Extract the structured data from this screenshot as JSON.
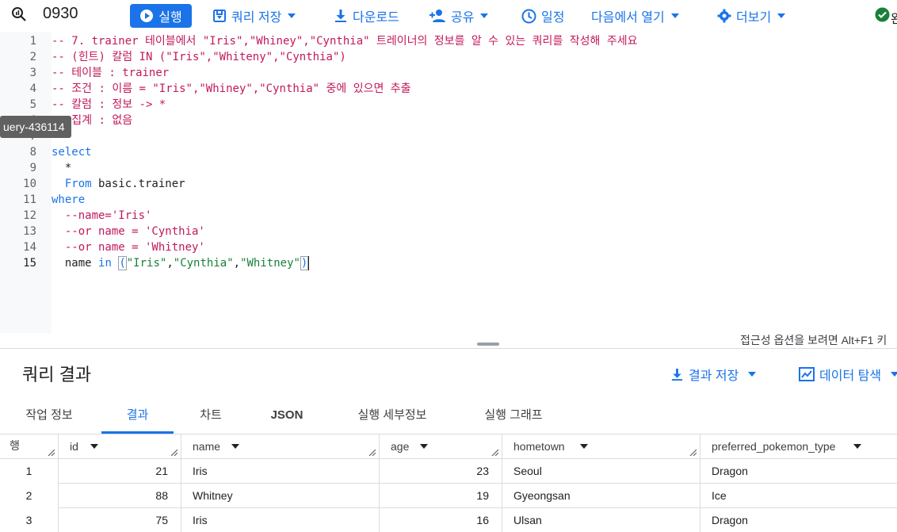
{
  "toolbar": {
    "query_name": "0930",
    "run_label": "실행",
    "save_query_label": "쿼리 저장",
    "download_label": "다운로드",
    "share_label": "공유",
    "schedule_label": "일정",
    "open_in_label": "다음에서 열기",
    "more_label": "더보기",
    "status_text": "완"
  },
  "tooltip": {
    "text": "uery-436114"
  },
  "editor": {
    "active_line": 15,
    "lines": [
      {
        "n": "1",
        "parts": [
          {
            "c": "cm",
            "t": "-- 7. trainer 테이블에서 \"Iris\",\"Whiney\",\"Cynthia\" 트레이너의 정보를 알 수 있는 쿼리를 작성해 주세요"
          }
        ]
      },
      {
        "n": "2",
        "parts": [
          {
            "c": "cm",
            "t": "-- (힌트) 칼럼 IN (\"Iris\",\"Whiteny\",\"Cynthia\")"
          }
        ]
      },
      {
        "n": "3",
        "parts": [
          {
            "c": "cm",
            "t": "-- 테이블 : trainer"
          }
        ]
      },
      {
        "n": "4",
        "parts": [
          {
            "c": "cm",
            "t": "-- 조건 : 이름 = \"Iris\",\"Whiney\",\"Cynthia\" 중에 있으면 추출"
          }
        ]
      },
      {
        "n": "5",
        "parts": [
          {
            "c": "cm",
            "t": "-- 칼럼 : 정보 -> *"
          }
        ]
      },
      {
        "n": "6",
        "parts": [
          {
            "c": "cm",
            "t": "-- 집계 : 없음"
          }
        ]
      },
      {
        "n": "7",
        "parts": []
      },
      {
        "n": "8",
        "parts": [
          {
            "c": "kw",
            "t": "select"
          }
        ]
      },
      {
        "n": "9",
        "parts": [
          {
            "c": "tx",
            "t": "  *"
          }
        ]
      },
      {
        "n": "10",
        "parts": [
          {
            "c": "kw",
            "t": "  From"
          },
          {
            "c": "tx",
            "t": " basic.trainer"
          }
        ]
      },
      {
        "n": "11",
        "parts": [
          {
            "c": "kw",
            "t": "where"
          }
        ]
      },
      {
        "n": "12",
        "parts": [
          {
            "c": "cm",
            "t": "  --name='Iris'"
          }
        ]
      },
      {
        "n": "13",
        "parts": [
          {
            "c": "cm",
            "t": "  --or name = 'Cynthia'"
          }
        ]
      },
      {
        "n": "14",
        "parts": [
          {
            "c": "cm",
            "t": "  --or name = 'Whitney'"
          }
        ]
      },
      {
        "n": "15",
        "parts": [
          {
            "c": "tx",
            "t": "  name "
          },
          {
            "c": "kw",
            "t": "in"
          },
          {
            "c": "tx",
            "t": " "
          },
          {
            "c": "br",
            "t": "("
          },
          {
            "c": "st",
            "t": "\"Iris\""
          },
          {
            "c": "tx",
            "t": ","
          },
          {
            "c": "st",
            "t": "\"Cynthia\""
          },
          {
            "c": "tx",
            "t": ","
          },
          {
            "c": "st",
            "t": "\"Whitney\""
          },
          {
            "c": "br",
            "t": ")"
          }
        ]
      }
    ]
  },
  "a11y_hint": "접근성 옵션을 보려면 Alt+F1 키",
  "results": {
    "title": "쿼리 결과",
    "save_results_label": "결과 저장",
    "explore_label": "데이터 탐색",
    "tabs": [
      "작업 정보",
      "결과",
      "차트",
      "JSON",
      "실행 세부정보",
      "실행 그래프"
    ],
    "active_tab": 1,
    "columns": [
      "행",
      "id",
      "name",
      "age",
      "hometown",
      "preferred_pokemon_type"
    ],
    "rows": [
      [
        "1",
        "21",
        "Iris",
        "23",
        "Seoul",
        "Dragon"
      ],
      [
        "2",
        "88",
        "Whitney",
        "19",
        "Gyeongsan",
        "Ice"
      ],
      [
        "3",
        "75",
        "Iris",
        "16",
        "Ulsan",
        "Dragon"
      ]
    ]
  },
  "colors": {
    "accent": "#1a73e8",
    "comment": "#c2185b",
    "string": "#188038",
    "success": "#188038"
  }
}
